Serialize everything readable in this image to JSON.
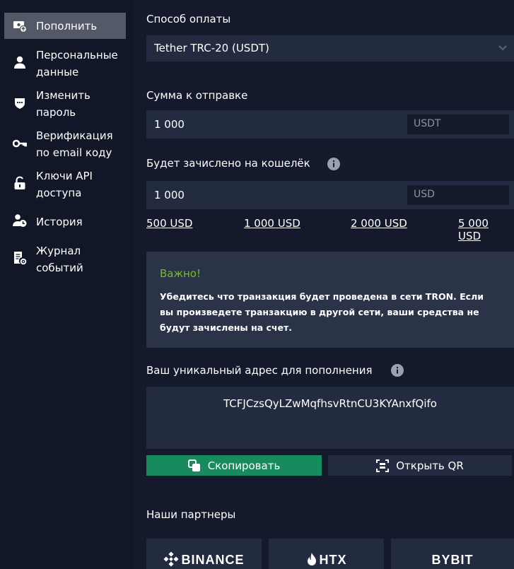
{
  "sidebar": {
    "items": [
      {
        "label": "Пополнить",
        "icon": "deposit-icon",
        "active": true
      },
      {
        "label_line1": "Персональные",
        "label_line2": "данные",
        "icon": "person-icon"
      },
      {
        "label_line1": "Изменить",
        "label_line2": "пароль",
        "icon": "password-shield-icon"
      },
      {
        "label_line1": "Верификация",
        "label_line2": "по email коду",
        "icon": "key-icon"
      },
      {
        "label_line1": "Ключи API",
        "label_line2": "доступа",
        "icon": "lock-icon"
      },
      {
        "label": "История",
        "icon": "user-clock-icon"
      },
      {
        "label_line1": "Журнал",
        "label_line2": "событий",
        "icon": "event-log-icon"
      }
    ]
  },
  "payment": {
    "method_label": "Способ оплаты",
    "method_value": "Tether TRC-20 (USDT)",
    "amount_label": "Сумма к отправке",
    "amount_value": "1 000",
    "amount_currency": "USDT",
    "credit_label": "Будет зачислено на кошелёк",
    "credit_value": "1 000",
    "credit_currency": "USD",
    "quick_amounts": [
      "500 USD",
      "1 000 USD",
      "2 000 USD",
      "5 000 USD"
    ]
  },
  "notice": {
    "title": "Важно!",
    "text": "Убедитесь что транзакция будет проведена в сети TRON. Если вы произведете транзакцию в другой сети, ваши средства не будут зачислены на счет."
  },
  "address": {
    "label": "Ваш уникальный адрес для пополнения",
    "value": "TCFJCzsQyLZwMqfhsvRtnCU3KYAnxfQifo"
  },
  "buttons": {
    "copy_label": "Скопировать",
    "qr_label": "Открыть QR"
  },
  "partners": {
    "label": "Наши партнеры",
    "items": [
      "BINANCE",
      "HTX",
      "BYBIT"
    ]
  },
  "colors": {
    "background": "#141a2b",
    "sidebar": "#111727",
    "active_item": "#535966",
    "panel": "#232b40",
    "copy_button": "#178a5e",
    "notice_title": "#78b832"
  }
}
